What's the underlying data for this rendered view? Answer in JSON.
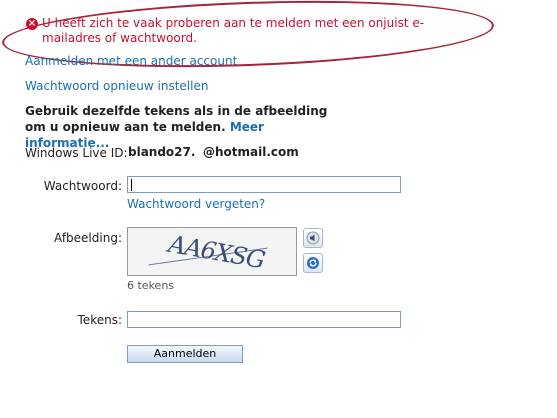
{
  "error": {
    "icon": "error-x-icon",
    "message": "U heeft zich te vaak proberen aan te melden met een onjuist e-mailadres of wachtwoord.",
    "color": "#c8102e",
    "annotation_color": "#a8223a"
  },
  "links": {
    "other_account": "Aanmelden met een ander account",
    "reset_password": "Wachtwoord opnieuw instellen",
    "forgot_password": "Wachtwoord vergeten?"
  },
  "instructions": {
    "text": "Gebruik dezelfde tekens als in de afbeelding om u opnieuw aan te melden.",
    "more_link": "Meer informatie..."
  },
  "account": {
    "label": "Windows Live ID:",
    "username": "blando27.",
    "domain": "@hotmail.com"
  },
  "form": {
    "password_label": "Wachtwoord:",
    "password_value": "",
    "image_label": "Afbeelding:",
    "captcha_text": "AA6XSG",
    "captcha_count": "6 tekens",
    "chars_label": "Tekens:",
    "chars_value": "",
    "submit_label": "Aanmelden",
    "audio_icon": "speaker-icon",
    "refresh_icon": "refresh-icon"
  },
  "colors": {
    "link": "#1b6fb2"
  }
}
